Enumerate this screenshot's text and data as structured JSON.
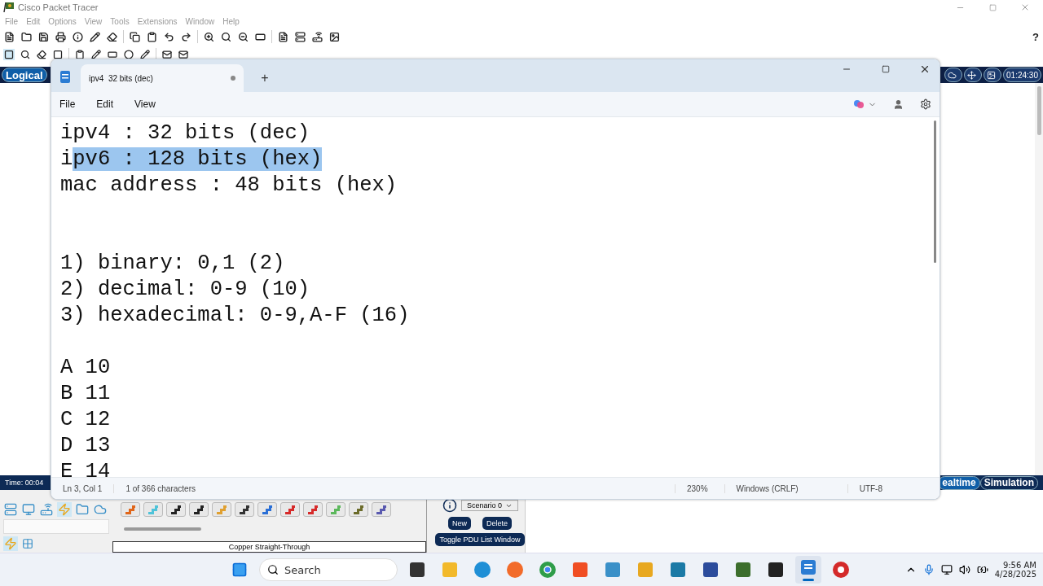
{
  "app": {
    "title": "Cisco Packet Tracer",
    "menu": [
      "File",
      "Edit",
      "Options",
      "View",
      "Tools",
      "Extensions",
      "Window",
      "Help"
    ],
    "help": "?"
  },
  "workspace": {
    "mode": "Logical",
    "timer": "01:24:30"
  },
  "sim_bar": {
    "time": "Time: 00:04",
    "realtime": "ealtime",
    "simulation": "Simulation"
  },
  "devices": {
    "selected_category": true
  },
  "cables": [
    {
      "color": "#e0661a"
    },
    {
      "color": "#4fc3d9"
    },
    {
      "color": "#222222"
    },
    {
      "color": "#222222"
    },
    {
      "color": "#e0a030"
    },
    {
      "color": "#333333"
    },
    {
      "color": "#2a6fd6"
    },
    {
      "color": "#d62a2a"
    },
    {
      "color": "#d62a2a"
    },
    {
      "color": "#5cb85c"
    },
    {
      "color": "#6b6b2a"
    },
    {
      "color": "#5a5ab0"
    }
  ],
  "cable_label": "Copper Straight-Through",
  "scenario": {
    "select": "Scenario 0",
    "buttons": [
      "New",
      "Delete"
    ],
    "toggle": "Toggle PDU List Window"
  },
  "notepad": {
    "tab": "ipv4  32 bits (dec)",
    "modified": true,
    "new_tab": "+",
    "menu": [
      "File",
      "Edit",
      "View"
    ],
    "lines": [
      {
        "kind": "text",
        "segments": [
          {
            "text": "ipv4 : 32 bits (dec)",
            "selected": false
          }
        ]
      },
      {
        "kind": "text",
        "segments": [
          {
            "text": "i",
            "selected": false
          },
          {
            "text": "pv6 : 128 bits (hex)",
            "selected": true
          }
        ]
      },
      {
        "kind": "text",
        "segments": [
          {
            "text": "mac address : 48 bits (hex)",
            "selected": false
          }
        ]
      },
      {
        "kind": "blank"
      },
      {
        "kind": "blank"
      },
      {
        "kind": "text",
        "segments": [
          {
            "text": "1) binary: 0,1 (2)",
            "selected": false
          }
        ]
      },
      {
        "kind": "text",
        "segments": [
          {
            "text": "2) decimal: 0-9 (10)",
            "selected": false
          }
        ]
      },
      {
        "kind": "text",
        "segments": [
          {
            "text": "3) hexadecimal: 0-9,A-F (16)",
            "selected": false
          }
        ]
      },
      {
        "kind": "blank"
      },
      {
        "kind": "text",
        "segments": [
          {
            "text": "A 10",
            "selected": false
          }
        ]
      },
      {
        "kind": "text",
        "segments": [
          {
            "text": "B 11",
            "selected": false
          }
        ]
      },
      {
        "kind": "text",
        "segments": [
          {
            "text": "C 12",
            "selected": false
          }
        ]
      },
      {
        "kind": "text",
        "segments": [
          {
            "text": "D 13",
            "selected": false
          }
        ]
      },
      {
        "kind": "text",
        "segments": [
          {
            "text": "E 14",
            "selected": false
          }
        ]
      }
    ],
    "status": {
      "position": "Ln 3, Col 1",
      "count": "1 of 366 characters",
      "zoom": "230%",
      "line_ending": "Windows (CRLF)",
      "encoding": "UTF-8"
    }
  },
  "taskbar": {
    "search": {
      "placeholder": "Search"
    },
    "apps": [
      {
        "kind": "terminal",
        "selected": false
      },
      {
        "kind": "folder",
        "selected": false
      },
      {
        "kind": "edge",
        "selected": false
      },
      {
        "kind": "firefox",
        "selected": false
      },
      {
        "kind": "chrome",
        "selected": false
      },
      {
        "kind": "brave",
        "selected": false
      },
      {
        "kind": "blocks",
        "selected": false
      },
      {
        "kind": "network",
        "selected": false
      },
      {
        "kind": "vs",
        "selected": false
      },
      {
        "kind": "pcs",
        "selected": false
      },
      {
        "kind": "tracer",
        "selected": false
      },
      {
        "kind": "g",
        "selected": false
      },
      {
        "kind": "notepad",
        "selected": true
      },
      {
        "kind": "recorder",
        "selected": false
      }
    ],
    "clock": {
      "time": "9:56 AM",
      "date": "4/28/2025"
    }
  }
}
